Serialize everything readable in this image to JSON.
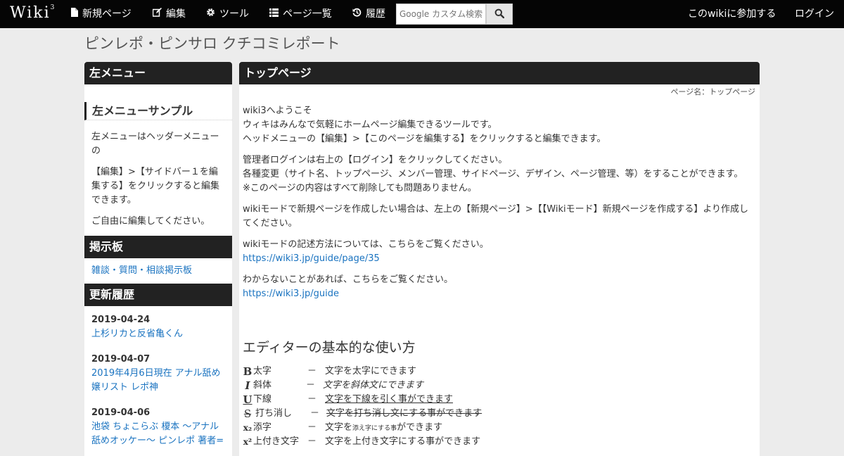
{
  "nav": {
    "brand": "Wiki",
    "brand_sup": "3",
    "items": [
      {
        "icon": "file-icon",
        "label": "新規ページ"
      },
      {
        "icon": "edit-icon",
        "label": "編集"
      },
      {
        "icon": "gear-icon",
        "label": "ツール"
      },
      {
        "icon": "list-icon",
        "label": "ページ一覧"
      },
      {
        "icon": "history-icon",
        "label": "履歴"
      }
    ],
    "search_placeholder": "Google カスタム検索",
    "join_label": "このwikiに参加する",
    "login_label": "ログイン"
  },
  "site_title": "ピンレポ・ピンサロ クチコミレポート",
  "sidebar": {
    "menu_title": "左メニュー",
    "sub_title": "左メニューサンプル",
    "paragraphs": [
      "左メニューはヘッダーメニューの",
      "【編集】>【サイドバー１を編集する】をクリックすると編集できます。",
      "ご自由に編集してください。"
    ],
    "board_title": "掲示板",
    "board_link": "雑談・質問・相談掲示板",
    "history_title": "更新履歴",
    "history": [
      {
        "date": "2019-04-24",
        "title": "上杉リカと反省亀くん"
      },
      {
        "date": "2019-04-07",
        "title": "2019年4月6日現在 アナル舐め嬢リスト レポ神"
      },
      {
        "date": "2019-04-06",
        "title": "池袋 ちょこらぶ 榎本 ～アナル舐めオッケー～ ピンレポ 著者="
      }
    ]
  },
  "main": {
    "title": "トップページ",
    "page_name": "ページ名：トップページ",
    "p1": [
      "wiki3へようこそ",
      "ウィキはみんなで気軽にホームページ編集できるツールです。",
      "ヘッドメニューの【編集】>【このページを編集する】をクリックすると編集できます。"
    ],
    "p2": [
      "管理者ログインは右上の【ログイン】をクリックしてください。",
      "各種変更（サイト名、トップページ、メンバー管理、サイドページ、デザイン、ページ管理、等）をすることができます。",
      "※このページの内容はすべて削除しても問題ありません。"
    ],
    "p3": "wikiモードで新規ページを作成したい場合は、左上の【新規ページ】>【【Wikiモード】新規ページを作成する】より作成してください。",
    "p4_text": "wikiモードの記述方法については、こちらをご覧ください。",
    "p4_link": "https://wiki3.jp/guide/page/35",
    "p5_text": "わからないことがあれば、こちらをご覧ください。",
    "p5_link": "https://wiki3.jp/guide",
    "editor_title": "エディターの基本的な使い方",
    "formats": [
      {
        "icon": "B",
        "name": "太字",
        "dash": "－",
        "desc": "文字を太字にできます"
      },
      {
        "icon": "I",
        "name": "斜体",
        "dash": "－",
        "desc": "文字を斜体文にできます"
      },
      {
        "icon": "U",
        "name": "下線",
        "dash": "－",
        "desc": "文字を下線を引く事ができます"
      },
      {
        "icon": "S",
        "name": "打ち消し",
        "dash": "－",
        "desc": "文字を打ち消し文にする事ができます"
      },
      {
        "icon": "x₂",
        "name": "添字",
        "dash": "－",
        "desc_a": "文字を",
        "desc_b": "添え字にする事",
        "desc_c": "ができます"
      },
      {
        "icon": "x²",
        "name": "上付き文字",
        "dash": "－",
        "desc": "文字を上付き文字にする事ができます"
      }
    ]
  }
}
